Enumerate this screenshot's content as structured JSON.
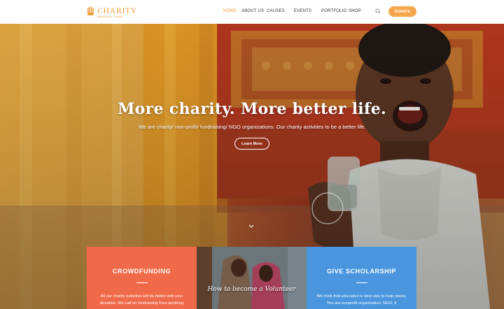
{
  "brand": {
    "name": "CHARITY",
    "tagline": "WordPress Theme",
    "accent_color": "#f39c3d"
  },
  "nav": {
    "items": [
      {
        "label": "HOME",
        "active": true
      },
      {
        "label": "ABOUT US",
        "active": false
      },
      {
        "label": "CAUSES",
        "active": false
      },
      {
        "label": "EVENTS",
        "active": false
      },
      {
        "label": "PORTFOLIO",
        "active": false
      },
      {
        "label": "SHOP",
        "active": false
      }
    ],
    "search_icon": "search-icon",
    "donate_label": "DONATE",
    "donate_color": "#f7a64d"
  },
  "hero": {
    "title": "More charity. More better life.",
    "subtitle": "We are charity/ non-profit/ fundraising/ NGO organizations. Our charity activities to be a better life.",
    "cta_label": "Learn More",
    "scroll_icon": "chevron-down-icon"
  },
  "cards": [
    {
      "title": "CROWDFUNDING",
      "text": "All our charity activities will be better with your donation. We call on fundraising from anything",
      "color": "#f06a4a"
    },
    {
      "script": "How to become a Volunteer",
      "color": "#6a7a84"
    },
    {
      "title": "GIVE SCHOLARSHIP",
      "text": "We think that education is best way to help needy. You are nonprofit organization, NGO, if",
      "color": "#4a95dd"
    }
  ]
}
